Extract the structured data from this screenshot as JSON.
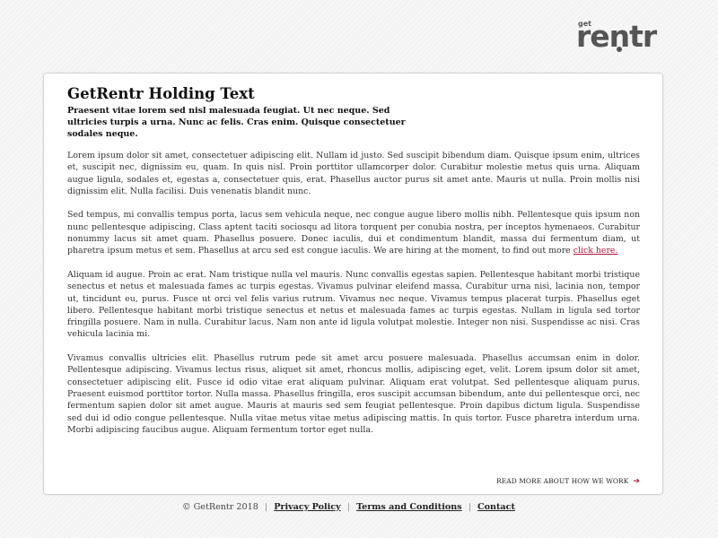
{
  "logo": {
    "small": "get",
    "main": "rentr"
  },
  "card": {
    "title": "GetRentr Holding Text",
    "subtitle": "Praesent vitae lorem sed nisl malesuada feugiat. Ut nec neque. Sed ultricies turpis a urna. Nunc ac felis. Cras enim. Quisque consectetuer sodales neque.",
    "paragraphs": [
      "Lorem ipsum dolor sit amet, consectetuer adipiscing elit. Nullam id justo. Sed suscipit bibendum diam. Quisque ipsum enim, ultrices et, suscipit nec, dignissim eu, quam. In quis nisl. Proin porttitor ullamcorper dolor. Curabitur molestie metus quis urna. Aliquam augue ligula, sodales et, egestas a, consectetuer quis, erat. Phasellus auctor purus sit amet ante. Mauris ut nulla. Proin mollis nisi dignissim elit. Nulla facilisi. Duis venenatis blandit nunc.",
      "Sed tempus, mi convallis tempus porta, lacus sem vehicula neque, nec congue augue libero mollis nibh. Pellentesque quis ipsum non nunc pellentesque adipiscing. Class aptent taciti sociosqu ad litora torquent per conubia nostra, per inceptos hymenaeos. Curabitur nonummy lacus sit amet quam. Phasellus posuere. Donec iaculis, dui et condimentum blandit, massa dui fermentum diam, ut pharetra ipsum metus et sem. Phasellus at arcu sed est congue iaculis. We are hiring at the moment, to find out more",
      "Aliquam id augue. Proin ac erat. Nam tristique nulla vel mauris. Nunc convallis egestas sapien. Pellentesque habitant morbi tristique senectus et netus et malesuada fames ac turpis egestas. Vivamus pulvinar eleifend massa. Curabitur urna nisi, lacinia non, tempor ut, tincidunt eu, purus. Fusce ut orci vel felis varius rutrum. Vivamus nec neque. Vivamus tempus placerat turpis. Phasellus eget libero. Pellentesque habitant morbi tristique senectus et netus et malesuada fames ac turpis egestas. Nullam in ligula sed tortor fringilla posuere. Nam in nulla. Curabitur lacus. Nam non ante id ligula volutpat molestie. Integer non nisi. Suspendisse ac nisi. Cras vehicula lacinia mi.",
      "Vivamus convallis ultricies elit. Phasellus rutrum pede sit amet arcu posuere malesuada. Phasellus accumsan enim in dolor. Pellentesque adipiscing. Vivamus lectus risus, aliquet sit amet, rhoncus mollis, adipiscing eget, velit. Lorem ipsum dolor sit amet, consectetuer adipiscing elit. Fusce id odio vitae erat aliquam pulvinar. Aliquam erat volutpat. Sed pellentesque aliquam purus. Praesent euismod porttitor tortor. Nulla massa. Phasellus fringilla, eros suscipit accumsan bibendum, ante dui pellentesque orci, nec fermentum sapien dolor sit amet augue. Mauris at mauris sed sem feugiat pellentesque. Proin dapibus dictum ligula. Suspendisse sed dui id odio congue pellentesque. Nulla vitae metus vitae metus adipiscing mattis. In quis tortor. Fusce pharetra interdum urna. Morbi adipiscing faucibus augue. Aliquam fermentum tortor eget nulla."
    ],
    "hiring_link": "click here.",
    "read_more": "READ MORE ABOUT HOW WE WORK",
    "arrow_icon": "arrow-right-icon"
  },
  "footer": {
    "copyright": "© GetRentr 2018",
    "separator": "|",
    "links": [
      "Privacy Policy",
      "Terms and Conditions",
      "Contact"
    ]
  },
  "colors": {
    "accent": "#b1183a",
    "logo": "#555555",
    "background": "#f3f3f3"
  }
}
